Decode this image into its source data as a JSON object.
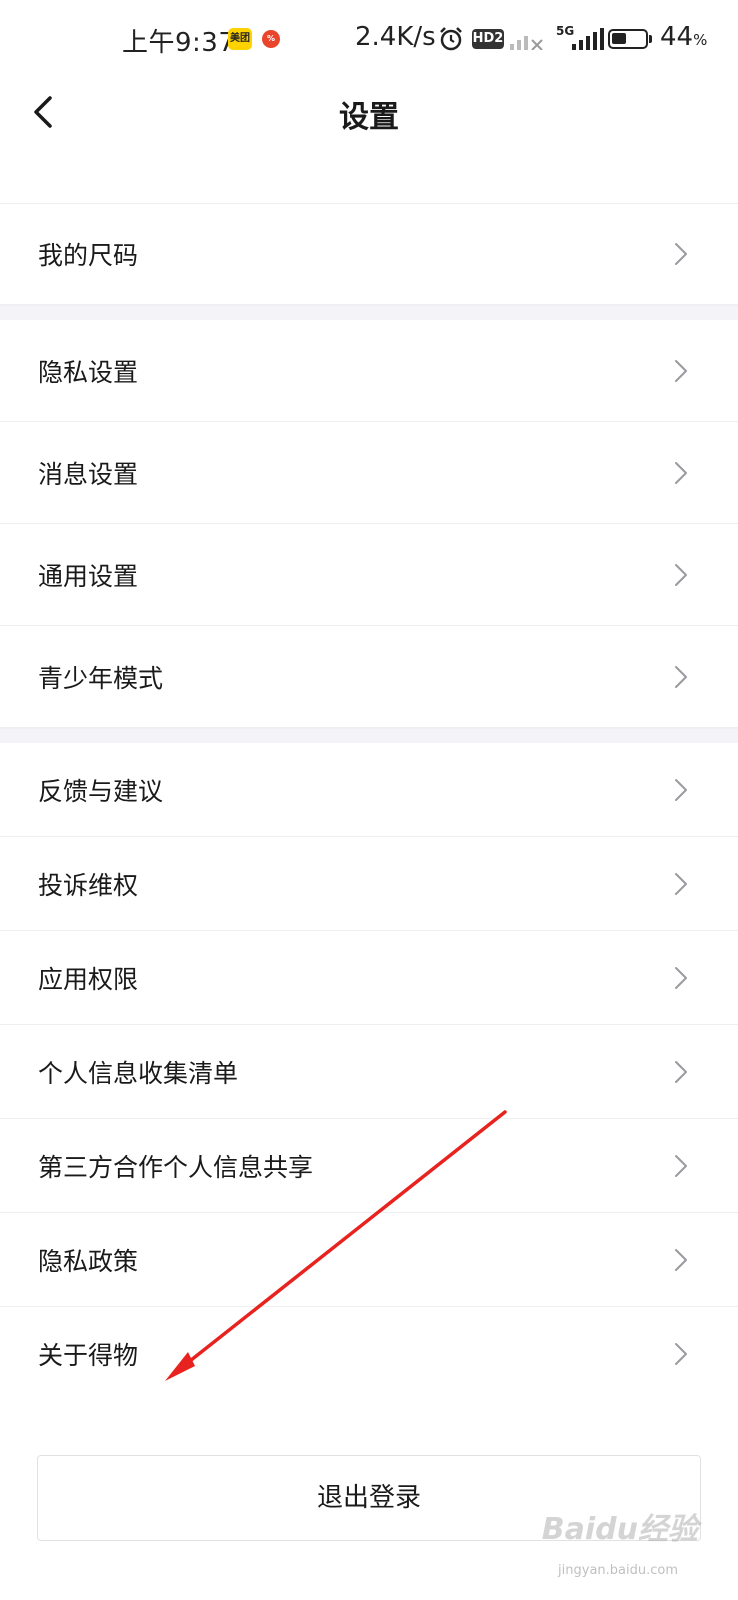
{
  "status_bar": {
    "time": "上午9:37",
    "meituan_badge": "美团",
    "net_speed": "2.4K/s",
    "hd_badge": "HD2",
    "network": "5G",
    "battery_level": 0.44,
    "battery_percent": "44",
    "battery_unit": "%"
  },
  "header": {
    "title": "设置",
    "back_icon": "chevron-left-icon"
  },
  "groups": [
    {
      "items": [
        {
          "label": "我的尺码"
        }
      ]
    },
    {
      "items": [
        {
          "label": "隐私设置"
        },
        {
          "label": "消息设置"
        },
        {
          "label": "通用设置"
        },
        {
          "label": "青少年模式"
        }
      ]
    },
    {
      "items": [
        {
          "label": "反馈与建议"
        },
        {
          "label": "投诉维权"
        },
        {
          "label": "应用权限"
        },
        {
          "label": "个人信息收集清单"
        },
        {
          "label": "第三方合作个人信息共享"
        },
        {
          "label": "隐私政策"
        },
        {
          "label": "关于得物"
        }
      ]
    }
  ],
  "logout_label": "退出登录",
  "watermark": {
    "text": "Baidu经验",
    "sub": "jingyan.baidu.com"
  },
  "colors": {
    "annotation_arrow": "#e8231f",
    "divider": "#efeff2",
    "section_gap": "#f4f4f8"
  }
}
